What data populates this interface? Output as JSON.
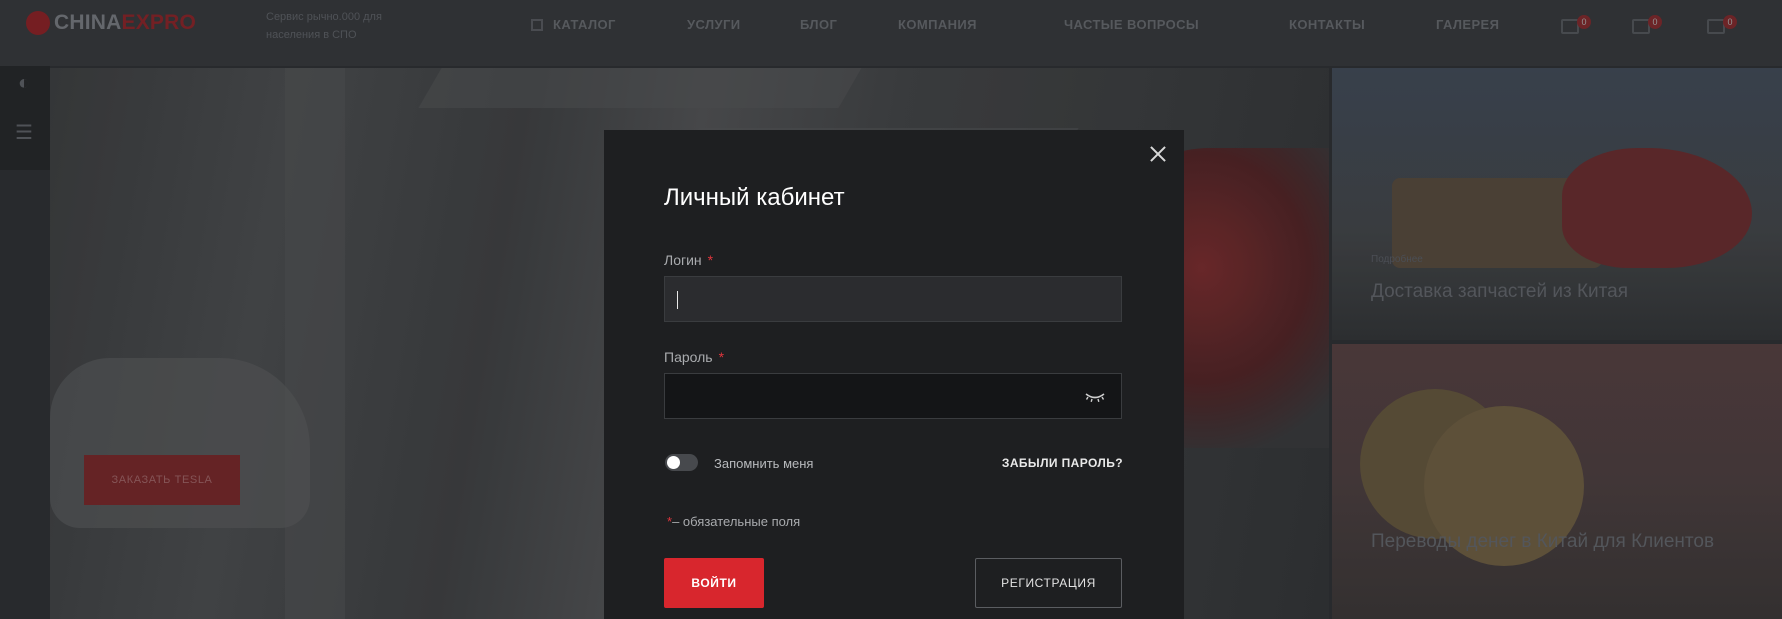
{
  "page": {
    "logo": {
      "part1": "CHINA",
      "part2": "EXPRO"
    },
    "tagline": "Сервис рычно.000 для населения в СПО",
    "nav": [
      {
        "label": "КАТАЛОГ"
      },
      {
        "label": "УСЛУГИ"
      },
      {
        "label": "БЛОГ"
      },
      {
        "label": "КОМПАНИЯ"
      },
      {
        "label": "ЧАСТЫЕ ВОПРОСЫ"
      },
      {
        "label": "КОНТАКТЫ"
      },
      {
        "label": "ГАЛЕРЕЯ"
      }
    ],
    "header_icons": [
      {
        "icon": "compare-icon",
        "count": "0"
      },
      {
        "icon": "heart-icon",
        "count": "0"
      },
      {
        "icon": "cart-icon",
        "count": "0"
      }
    ],
    "hero": {
      "title_line1": "...",
      "title_line2": "...",
      "button": "ЗАКАЗАТЬ TESLA"
    },
    "cards": [
      {
        "small": "Подробнее",
        "title": "Доставка запчастей из Китая"
      },
      {
        "title": "Переводы денег в Китай для Клиентов"
      }
    ]
  },
  "modal": {
    "title": "Личный кабинет",
    "login": {
      "label": "Логин",
      "required_mark": "*",
      "value": ""
    },
    "password": {
      "label": "Пароль",
      "required_mark": "*",
      "value": "",
      "toggle_icon": "eye-closed-icon"
    },
    "remember_label": "Запомнить меня",
    "remember_checked": false,
    "forgot_link": "ЗАБЫЛИ ПАРОЛЬ?",
    "required_note_mark": "*",
    "required_note": "– обязательные поля",
    "login_button": "ВОЙТИ",
    "register_button": "РЕГИСТРАЦИЯ",
    "close_icon": "close-icon"
  },
  "colors": {
    "accent": "#d8262d",
    "modal_bg": "#1e1f21",
    "overlay_bg": "#2b2d30"
  }
}
